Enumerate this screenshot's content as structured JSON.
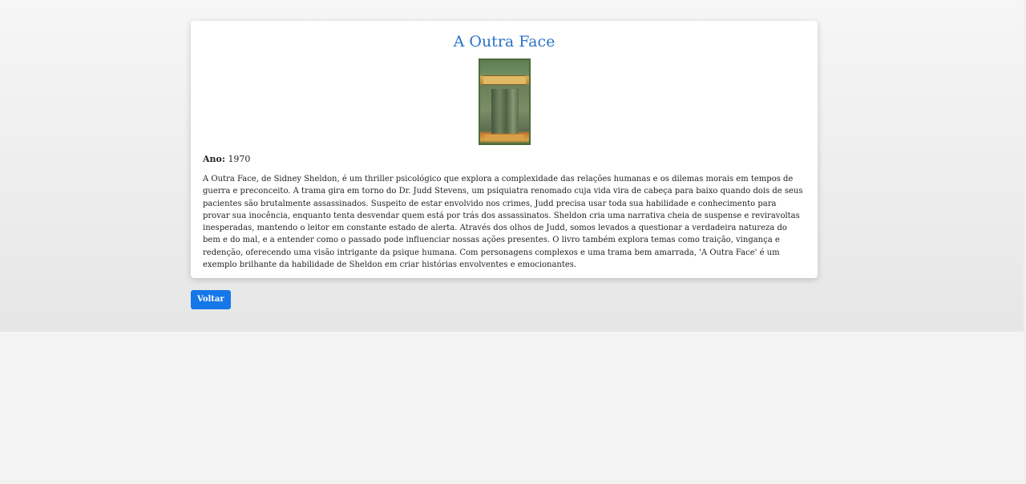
{
  "book": {
    "title": "A Outra Face",
    "cover_alt": "Capa do livro A Outra Face",
    "year_label": "Ano:",
    "year": "1970",
    "description": "A Outra Face, de Sidney Sheldon, é um thriller psicológico que explora a complexidade das relações humanas e os dilemas morais em tempos de guerra e preconceito. A trama gira em torno do Dr. Judd Stevens, um psiquiatra renomado cuja vida vira de cabeça para baixo quando dois de seus pacientes são brutalmente assassinados. Suspeito de estar envolvido nos crimes, Judd precisa usar toda sua habilidade e conhecimento para provar sua inocência, enquanto tenta desvendar quem está por trás dos assassinatos. Sheldon cria uma narrativa cheia de suspense e reviravoltas inesperadas, mantendo o leitor em constante estado de alerta. Através dos olhos de Judd, somos levados a questionar a verdadeira natureza do bem e do mal, e a entender como o passado pode influenciar nossas ações presentes. O livro também explora temas como traição, vingança e redenção, oferecendo uma visão intrigante da psique humana. Com personagens complexos e uma trama bem amarrada, 'A Outra Face' é um exemplo brilhante da habilidade de Sheldon em criar histórias envolventes e emocionantes."
  },
  "actions": {
    "back_label": "Voltar"
  },
  "colors": {
    "title": "#2a72c8",
    "button": "#1677e8",
    "card": "#ffffff",
    "background": "#f3f3f3"
  }
}
